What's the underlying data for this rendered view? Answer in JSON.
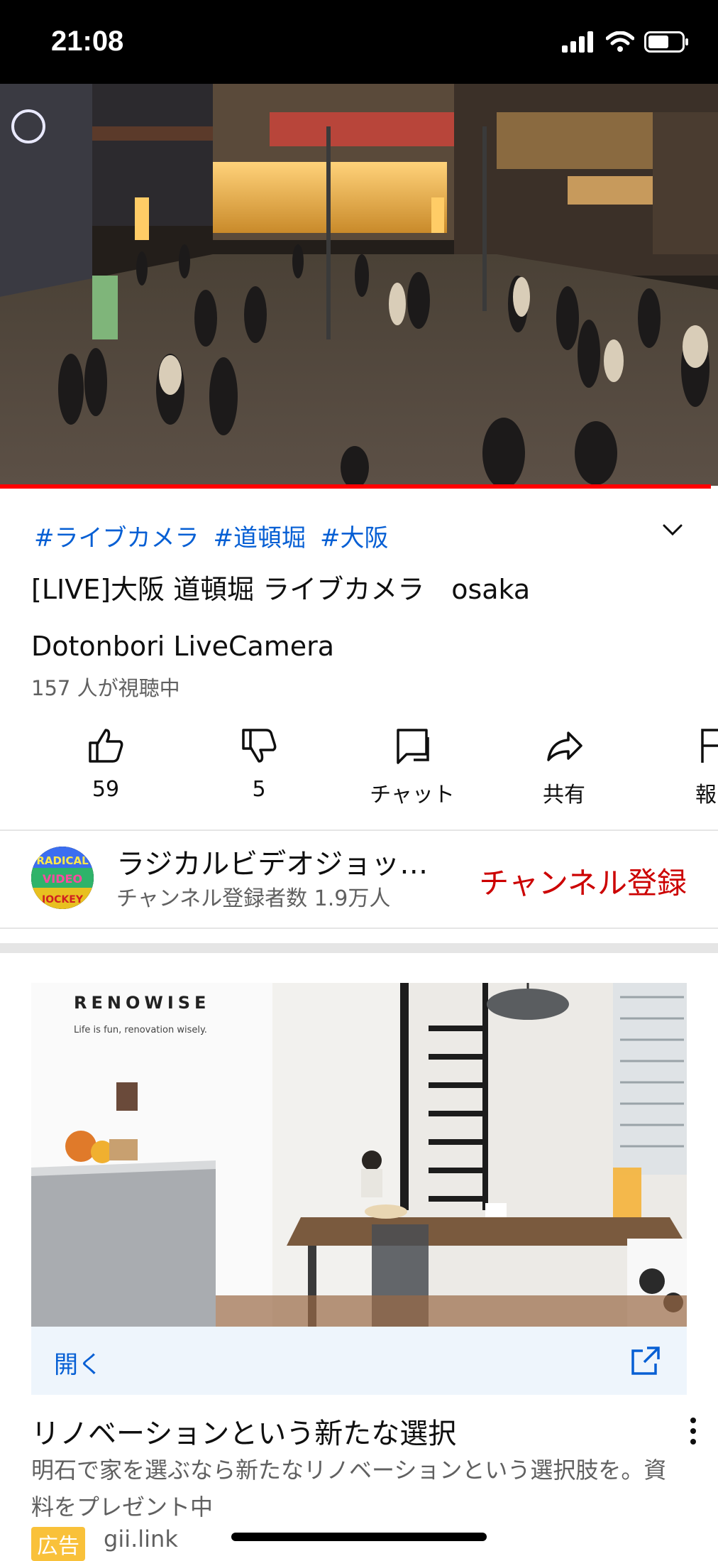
{
  "status_bar": {
    "time": "21:08",
    "icons": [
      "signal-icon",
      "wifi-icon",
      "battery-icon"
    ]
  },
  "video": {
    "progress": 0.99
  },
  "info": {
    "hashtags": [
      "#ライブカメラ",
      "#道頓堀",
      "#大阪"
    ],
    "title_line1": "[LIVE]大阪 道頓堀 ライブカメラ　osaka",
    "title_line2": "Dotonbori LiveCamera",
    "viewers": "157 人が視聴中"
  },
  "actions": [
    {
      "icon": "thumbs-up-icon",
      "label": "59"
    },
    {
      "icon": "thumbs-down-icon",
      "label": "5"
    },
    {
      "icon": "chat-icon",
      "label": "チャット"
    },
    {
      "icon": "share-icon",
      "label": "共有"
    },
    {
      "icon": "report-icon",
      "label": "報"
    }
  ],
  "channel": {
    "name": "ラジカルビデオジョッキー",
    "subscribers": "チャンネル登録者数 1.9万人",
    "subscribe_label": "チャンネル登録",
    "avatar_text": "RADICAL VIDEO JOCKEY"
  },
  "ad": {
    "brand": "RENOWISE",
    "tagline": "Life is fun, renovation wisely.",
    "open_label": "開く",
    "title": "リノベーションという新たな選択",
    "description": "明石で家を選ぶなら新たなリノベーションという選択肢を。資料をプレゼント中",
    "badge": "広告",
    "domain": "gii.link"
  },
  "colors": {
    "accent_blue": "#065fd4",
    "subscribe_red": "#cc0000",
    "progress_red": "#ff0000",
    "ad_badge": "#f9c13a"
  }
}
